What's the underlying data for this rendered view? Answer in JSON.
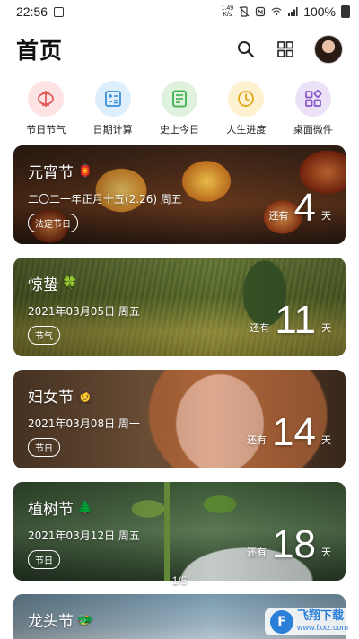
{
  "status_bar": {
    "time": "22:56",
    "net_speed_value": "1.49",
    "net_speed_unit": "K/s",
    "battery": "100%"
  },
  "header": {
    "title": "首页",
    "search_icon": "search-icon",
    "grid_icon": "grid-icon"
  },
  "quick_actions": [
    {
      "label": "节日节气",
      "icon": "lantern-icon",
      "color": "#fde3e3",
      "fg": "#e25c5c"
    },
    {
      "label": "日期计算",
      "icon": "calculator-icon",
      "color": "#ddeefc",
      "fg": "#3c8fd8"
    },
    {
      "label": "史上今日",
      "icon": "document-icon",
      "color": "#dff2dd",
      "fg": "#3fae4f"
    },
    {
      "label": "人生进度",
      "icon": "clock-icon",
      "color": "#fdf1cf",
      "fg": "#e0a81c"
    },
    {
      "label": "桌面微件",
      "icon": "widgets-icon",
      "color": "#ece2f7",
      "fg": "#8a5ac8"
    }
  ],
  "cards": [
    {
      "name": "元宵节",
      "emoji": "🏮",
      "date": "二〇二一年正月十五(2.26) 周五",
      "tag": "法定节日",
      "prefix": "还有",
      "days": "4",
      "unit": "天",
      "bg": "bg-lantern"
    },
    {
      "name": "惊蛰",
      "emoji": "🍀",
      "date": "2021年03月05日 周五",
      "tag": "节气",
      "prefix": "还有",
      "days": "11",
      "unit": "天",
      "bg": "bg-field"
    },
    {
      "name": "妇女节",
      "emoji": "👩",
      "date": "2021年03月08日 周一",
      "tag": "节日",
      "prefix": "还有",
      "days": "14",
      "unit": "天",
      "bg": "bg-woman"
    },
    {
      "name": "植树节",
      "emoji": "🌲",
      "date": "2021年03月12日 周五",
      "tag": "节日",
      "prefix": "还有",
      "days": "18",
      "unit": "天",
      "bg": "bg-sprout"
    }
  ],
  "partial_card": {
    "name": "龙头节",
    "emoji": "🐲"
  },
  "pager": "1/5",
  "watermark": {
    "cn": "飞翔下载",
    "en": "www.fxxz.com"
  }
}
